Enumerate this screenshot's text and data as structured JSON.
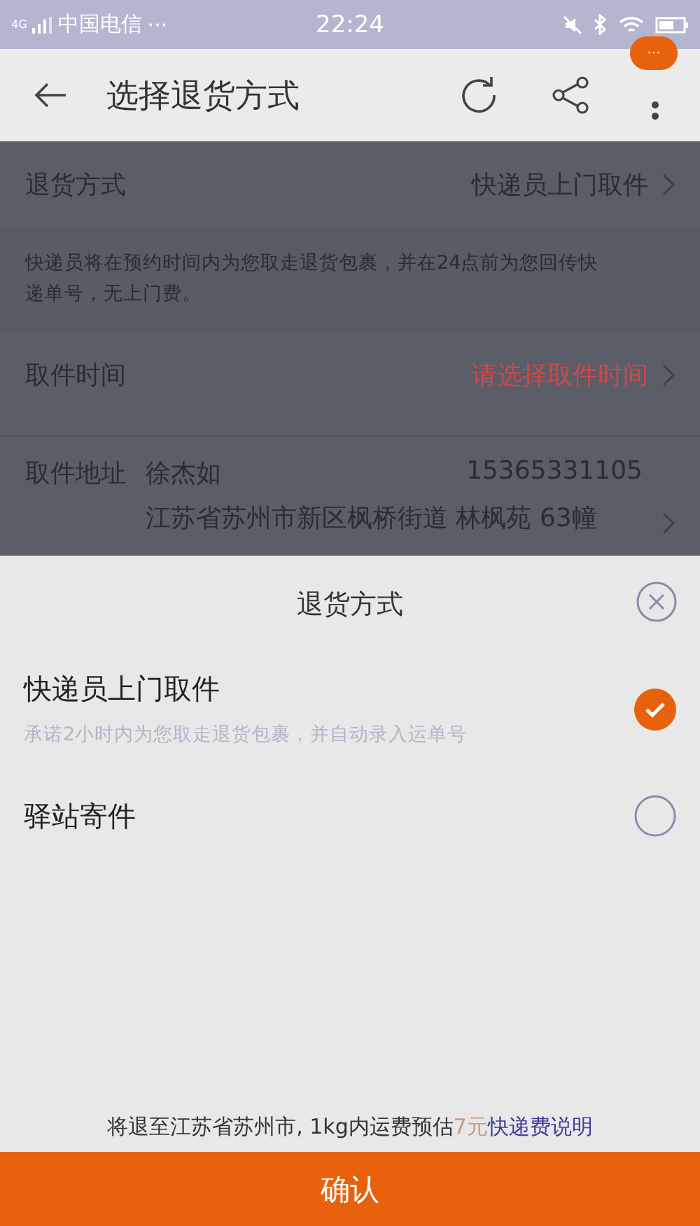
{
  "status_bar": {
    "network": "4G",
    "carrier": "中国电信",
    "dots": "···",
    "time": "22:24"
  },
  "header": {
    "title": "选择退货方式",
    "badge": "···"
  },
  "form": {
    "rows": [
      {
        "kind": "select",
        "label": "退货方式",
        "value": "快递员上门取件",
        "placeholder": false
      },
      {
        "kind": "note",
        "text": "快递员将在预约时间内为您取走退货包裹，并在24点前为您回传快递单号，无上门费。"
      },
      {
        "kind": "select",
        "label": "取件时间",
        "value": "请选择取件时间",
        "placeholder": true
      },
      {
        "kind": "address",
        "label": "取件地址",
        "name": "徐杰如",
        "phone": "15365331105",
        "address": "江苏省苏州市新区枫桥街道 林枫苑 63幢"
      }
    ]
  },
  "sheet": {
    "title": "退货方式",
    "options": [
      {
        "title": "快递员上门取件",
        "description": "承诺2小时内为您取走退货包裹，并自动录入运单号",
        "selected": true
      },
      {
        "title": "驿站寄件",
        "selected": false
      }
    ],
    "footer": {
      "text": "将退至江苏省苏州市, 1kg内运费预估",
      "price": "7元",
      "link": "快递费说明"
    },
    "confirm": "确认"
  }
}
